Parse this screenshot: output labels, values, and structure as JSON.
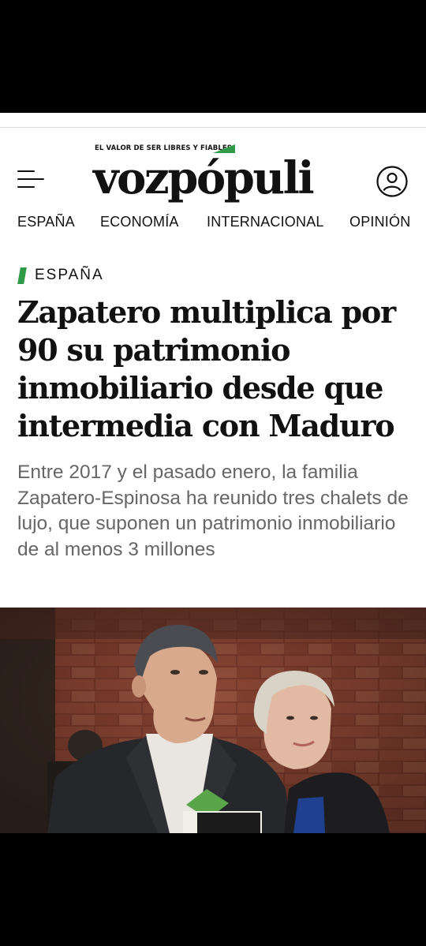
{
  "header": {
    "tagline": "EL VALOR DE SER LIBRES Y FIABLES",
    "logo_text": "vozpópuli",
    "accent_color": "#2f9a48"
  },
  "nav": {
    "items": [
      "ESPAÑA",
      "ECONOMÍA",
      "INTERNACIONAL",
      "OPINIÓN"
    ]
  },
  "article": {
    "section": "ESPAÑA",
    "headline": "Zapatero multiplica por 90 su patrimonio inmobiliario desde que intermedia con Maduro",
    "subtitle": "Entre 2017 y el pasado enero, la familia Zapatero-Espinosa ha reunido tres chalets de lujo, que suponen un patrimonio inmobiliario de al menos 3 millones"
  },
  "icons": {
    "menu": "hamburger-menu-icon",
    "user": "user-account-icon"
  }
}
